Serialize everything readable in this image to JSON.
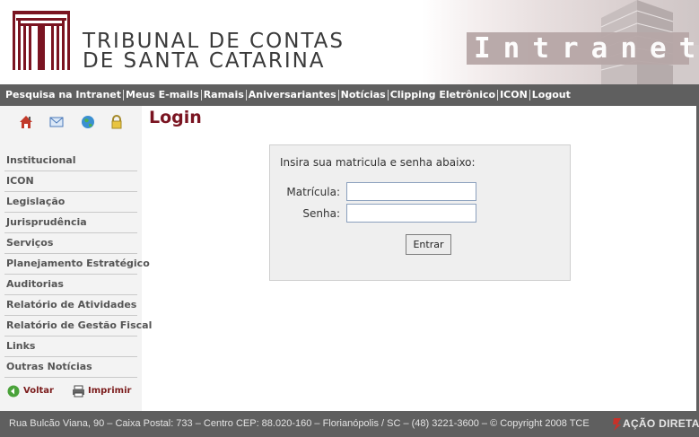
{
  "header": {
    "org_line1": "TRIBUNAL DE CONTAS",
    "org_line2": "DE SANTA CATARINA",
    "banner_text": "Intranet"
  },
  "topnav": {
    "items": [
      "Pesquisa na Intranet",
      "Meus E-mails",
      "Ramais",
      "Aniversariantes",
      "Notícias",
      "Clipping Eletrônico",
      "ICON",
      "Logout"
    ]
  },
  "sidebar": {
    "icons": [
      "home-icon",
      "mail-icon",
      "globe-icon",
      "lock-icon"
    ],
    "items": [
      "Institucional",
      "ICON",
      "Legislação",
      "Jurisprudência",
      "Serviços",
      "Planejamento Estratégico",
      "Auditorias",
      "Relatório de Atividades",
      "Relatório de Gestão Fiscal",
      "Links",
      "Outras Notícias"
    ],
    "back_label": "Voltar",
    "print_label": "Imprimir"
  },
  "main": {
    "title": "Login",
    "instructions": "Insira sua matricula e senha abaixo:",
    "matricula_label": "Matrícula:",
    "senha_label": "Senha:",
    "matricula_value": "",
    "senha_value": "",
    "submit_label": "Entrar"
  },
  "footer": {
    "text": "Rua Bulcão Viana, 90 – Caixa Postal: 733 – Centro CEP: 88.020-160 – Florianópolis / SC – (48) 3221-3600 – © Copyright 2008 TCE",
    "brand": "AÇÃO DIRETA"
  },
  "colors": {
    "brand": "#7a1421",
    "nav_bg": "#5f5f5f",
    "sidebar_bg": "#f3f3f3"
  }
}
